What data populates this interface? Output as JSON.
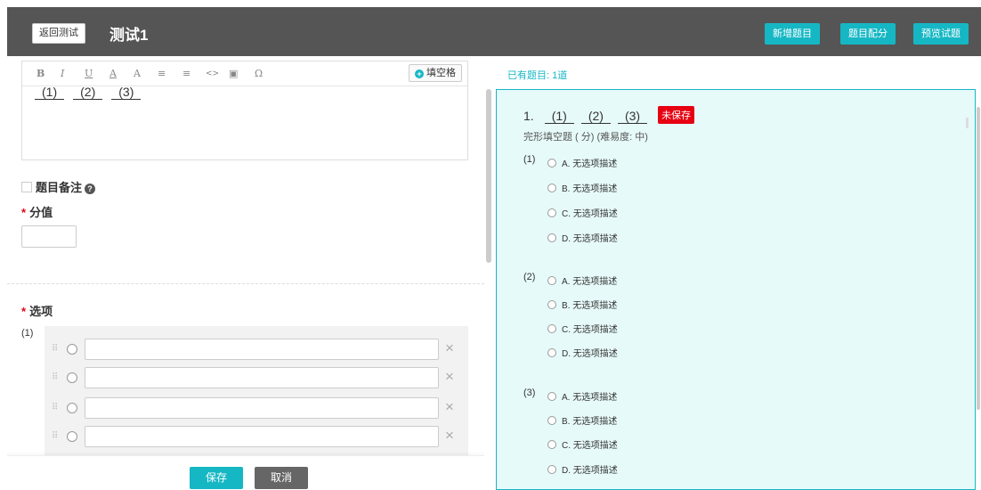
{
  "header": {
    "back_label": "返回测试",
    "title": "测试1",
    "buttons": [
      "新增题目",
      "题目配分",
      "预览试题"
    ]
  },
  "editor": {
    "toolbar_icons": [
      "B",
      "I",
      "U",
      "A",
      "A",
      "≡",
      "≡",
      "<>",
      "▣",
      "Ω"
    ],
    "fill_blank_label": "填空格",
    "blanks": [
      "(1)",
      "(2)",
      "(3)"
    ]
  },
  "form": {
    "note_label": "题目备注",
    "score_label": "分值",
    "options_label": "选项",
    "blank_index": "(1)",
    "option_rows": 4
  },
  "footer": {
    "save_label": "保存",
    "cancel_label": "取消"
  },
  "preview": {
    "count_label": "已有题目: 1道",
    "question": {
      "number": "1.",
      "blanks": [
        "(1)",
        "(2)",
        "(3)"
      ],
      "status": "未保存",
      "meta": "完形填空题 ( 分) (难易度: 中)",
      "groups": [
        {
          "index": "(1)",
          "options": [
            "A. 无选项描述",
            "B. 无选项描述",
            "C. 无选项描述",
            "D. 无选项描述"
          ]
        },
        {
          "index": "(2)",
          "options": [
            "A. 无选项描述",
            "B. 无选项描述",
            "C. 无选项描述",
            "D. 无选项描述"
          ]
        },
        {
          "index": "(3)",
          "options": [
            "A. 无选项描述",
            "B. 无选项描述",
            "C. 无选项描述",
            "D. 无选项描述"
          ]
        }
      ]
    }
  },
  "colors": {
    "accent": "#16b7c4",
    "header_bg": "#555555",
    "danger": "#e60012",
    "preview_bg": "#e7fafa"
  }
}
